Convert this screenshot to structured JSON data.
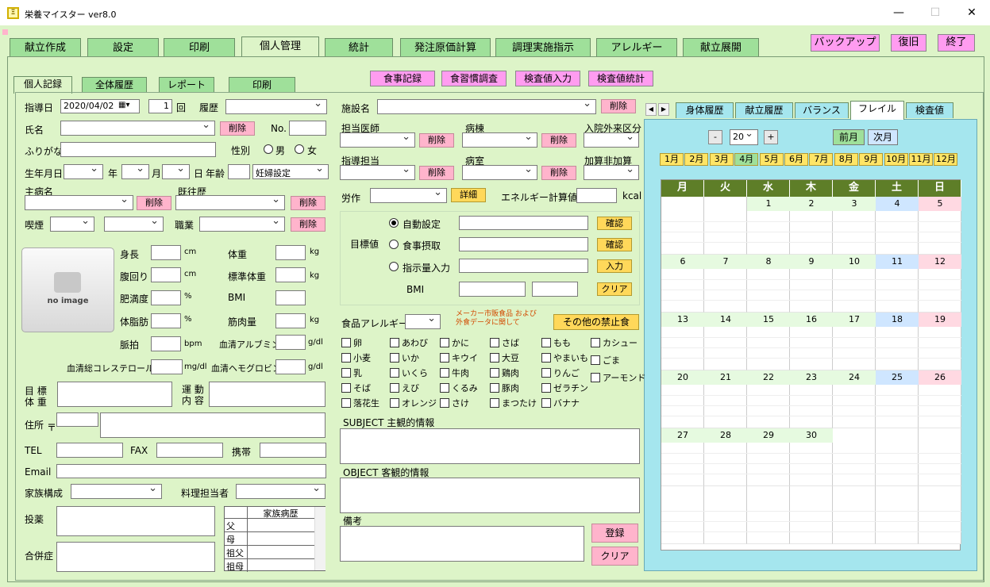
{
  "window": {
    "title": "栄養マイスター ver8.0",
    "minimize": "—",
    "maximize": "☐",
    "close": "✕"
  },
  "main_tabs": [
    "献立作成",
    "設定",
    "印刷",
    "個人管理",
    "統計",
    "発注原価計算",
    "調理実施指示",
    "アレルギー",
    "献立展開"
  ],
  "top_buttons": {
    "backup": "バックアップ",
    "restore": "復旧",
    "exit": "終了"
  },
  "sub_tabs": [
    "個人記録",
    "全体履歴",
    "レポート",
    "印刷"
  ],
  "center_buttons": [
    "食事記録",
    "食習慣調査",
    "検査値入力",
    "検査値統計"
  ],
  "left": {
    "guide_date_label": "指導日",
    "guide_date": "2020/04/02",
    "count": "1",
    "count_unit": "回",
    "history_label": "履歴",
    "name_label": "氏名",
    "delete": "削除",
    "no_label": "No.",
    "kana_label": "ふりがな",
    "gender_label": "性別",
    "male": "男",
    "female": "女",
    "birth_label": "生年月日",
    "year": "年",
    "month": "月",
    "day": "日",
    "age_label": "年齢",
    "pregnancy": "妊婦設定",
    "disease_label": "主病名",
    "past_label": "既往歴",
    "smoke_label": "喫煙",
    "job_label": "職業",
    "no_image": "no image",
    "height": "身長",
    "waist": "腹回り",
    "obesity": "肥満度",
    "body_fat": "体脂肪",
    "pulse": "脈拍",
    "weight": "体重",
    "std_weight": "標準体重",
    "bmi": "BMI",
    "muscle": "筋肉量",
    "albumin": "血清アルブミン",
    "cholesterol": "血清総コレステロール",
    "hemoglobin": "血清ヘモグロビン",
    "u_cm": "cm",
    "u_pct": "%",
    "u_bpm": "bpm",
    "u_kg": "kg",
    "u_gdl": "g/dl",
    "u_mgdl": "mg/dl",
    "target_weight": "目 標\n体 重",
    "exercise": "運 動\n内 容",
    "address": "住所",
    "postal": "〒",
    "tel": "TEL",
    "fax": "FAX",
    "mobile": "携帯",
    "email": "Email",
    "family": "家族構成",
    "cook": "料理担当者",
    "medication": "投薬",
    "complication": "合併症",
    "family_history": "家族病歴",
    "relatives": [
      "父",
      "母",
      "祖父",
      "祖母"
    ]
  },
  "middle": {
    "facility": "施設名",
    "doctor": "担当医師",
    "ward": "病棟",
    "inout": "入院外来区分",
    "instructor": "指導担当",
    "room": "病室",
    "addition": "加算非加算",
    "labor": "労作",
    "detail": "詳細",
    "energy_label": "エネルギー計算値",
    "kcal": "kcal",
    "target_label": "目標値",
    "auto": "自動設定",
    "meal": "食事摂取",
    "instruct": "指示量入力",
    "confirm": "確認",
    "input": "入力",
    "clear": "クリア",
    "bmi": "BMI",
    "allergy_label": "食品アレルギー",
    "maker_note": "メーカー市販食品 および\n外食データに関して",
    "other_ban": "その他の禁止食",
    "allergens": [
      [
        "卵",
        "あわび",
        "かに",
        "さば",
        "もも",
        "カシュー"
      ],
      [
        "小麦",
        "いか",
        "キウイ",
        "大豆",
        "やまいも",
        "ごま"
      ],
      [
        "乳",
        "いくら",
        "牛肉",
        "鶏肉",
        "りんご",
        "アーモンド"
      ],
      [
        "そば",
        "えび",
        "くるみ",
        "豚肉",
        "ゼラチン"
      ],
      [
        "落花生",
        "オレンジ",
        "さけ",
        "まつたけ",
        "バナナ"
      ]
    ],
    "subject": "SUBJECT 主観的情報",
    "object": "OBJECT 客観的情報",
    "note": "備考",
    "register": "登録",
    "clear2": "クリア"
  },
  "right": {
    "tabs": [
      "身体履歴",
      "献立履歴",
      "バランス",
      "フレイル",
      "検査値"
    ],
    "nav_left": "◀",
    "nav_right": "▶",
    "year_minus": "-",
    "year": "20",
    "year_plus": "+",
    "prev_month": "前月",
    "next_month": "次月",
    "months": [
      "1月",
      "2月",
      "3月",
      "4月",
      "5月",
      "6月",
      "7月",
      "8月",
      "9月",
      "10月",
      "11月",
      "12月"
    ],
    "weekdays": [
      "月",
      "火",
      "水",
      "木",
      "金",
      "土",
      "日"
    ],
    "weeks": [
      [
        "",
        "",
        "1",
        "2",
        "3",
        "4",
        "5"
      ],
      [
        "6",
        "7",
        "8",
        "9",
        "10",
        "11",
        "12"
      ],
      [
        "13",
        "14",
        "15",
        "16",
        "17",
        "18",
        "19"
      ],
      [
        "20",
        "21",
        "22",
        "23",
        "24",
        "25",
        "26"
      ],
      [
        "27",
        "28",
        "29",
        "30",
        "",
        "",
        ""
      ],
      [
        "",
        "",
        "",
        "",
        "",
        "",
        ""
      ]
    ],
    "colors": {
      "weekday": "#e6fae0",
      "sat": "#cfe6ff",
      "sun": "#ffd9e2",
      "header": "#5e7e28"
    }
  }
}
